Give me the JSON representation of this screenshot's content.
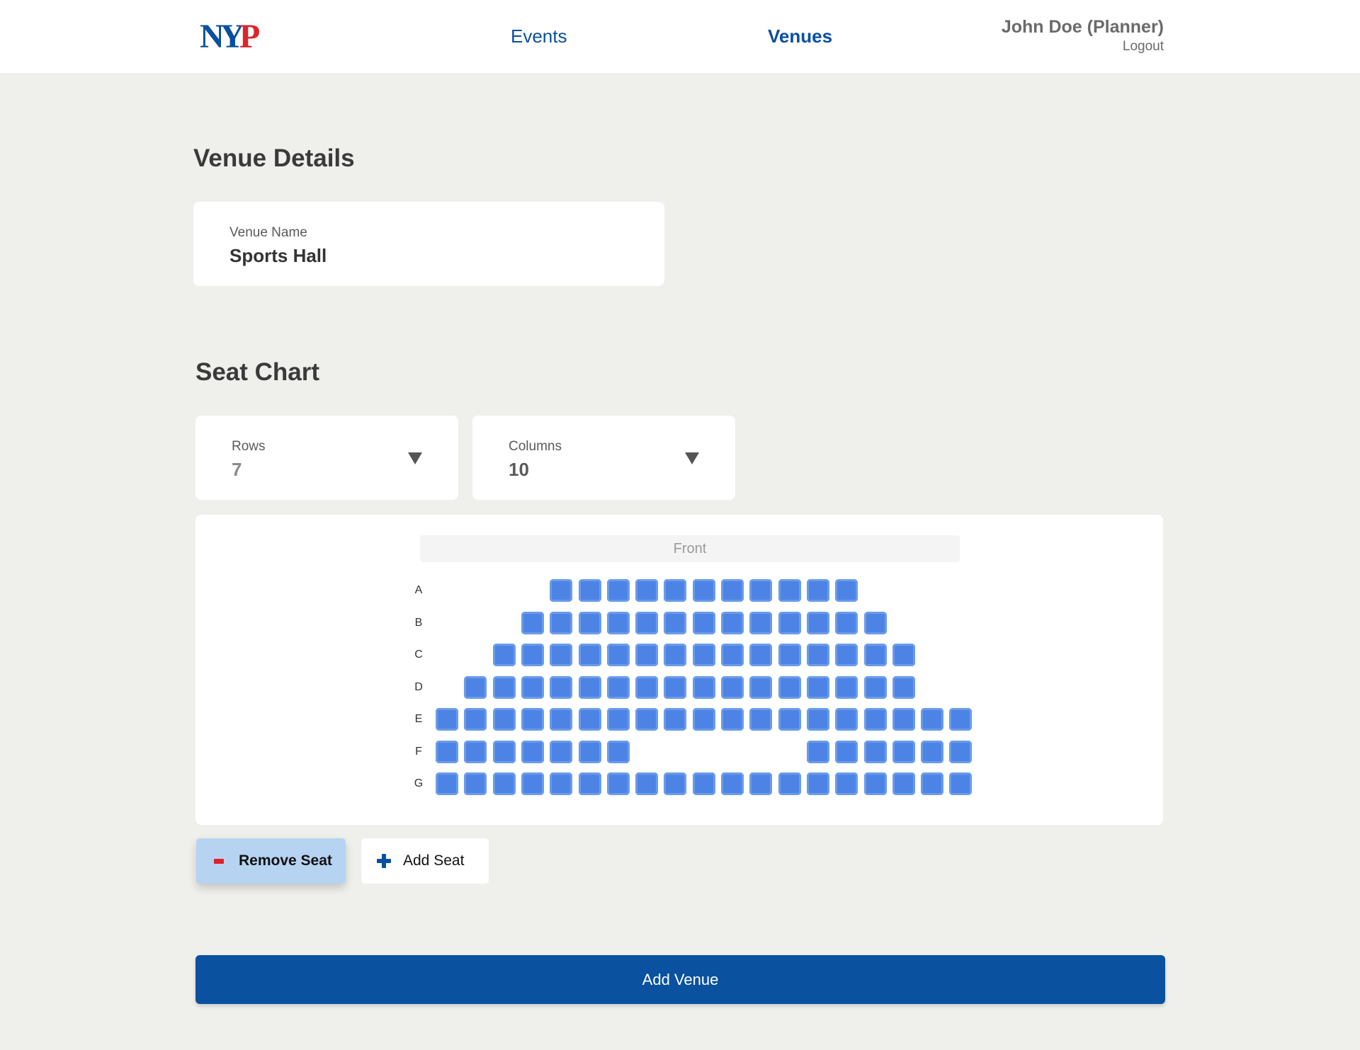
{
  "header": {
    "logo_text": "NYP",
    "nav": [
      {
        "label": "Events",
        "active": false
      },
      {
        "label": "Venues",
        "active": true
      }
    ],
    "user_name": "John Doe (Planner)",
    "logout_label": "Logout"
  },
  "venue_details": {
    "title": "Venue Details",
    "name_label": "Venue Name",
    "name_value": "Sports Hall"
  },
  "seat_chart": {
    "title": "Seat Chart",
    "rows_label": "Rows",
    "rows_value": "7",
    "columns_label": "Columns",
    "columns_value": "10",
    "front_label": "Front",
    "seat_color": "#4e83e6",
    "rows": [
      {
        "label": "A",
        "seats": [
          5,
          6,
          7,
          8,
          9,
          10,
          11,
          12,
          13,
          14,
          15
        ]
      },
      {
        "label": "B",
        "seats": [
          4,
          5,
          6,
          7,
          8,
          9,
          10,
          11,
          12,
          13,
          14,
          15,
          16
        ]
      },
      {
        "label": "C",
        "seats": [
          3,
          4,
          5,
          6,
          7,
          8,
          9,
          10,
          11,
          12,
          13,
          14,
          15,
          16,
          17
        ]
      },
      {
        "label": "D",
        "seats": [
          2,
          3,
          4,
          5,
          6,
          7,
          8,
          9,
          10,
          11,
          12,
          13,
          14,
          15,
          16,
          17
        ]
      },
      {
        "label": "E",
        "seats": [
          1,
          2,
          3,
          4,
          5,
          6,
          7,
          8,
          9,
          10,
          11,
          12,
          13,
          14,
          15,
          16,
          17,
          18,
          19
        ]
      },
      {
        "label": "F",
        "seats": [
          1,
          2,
          3,
          4,
          5,
          6,
          7,
          14,
          15,
          16,
          17,
          18,
          19
        ]
      },
      {
        "label": "G",
        "seats": [
          1,
          2,
          3,
          4,
          5,
          6,
          7,
          8,
          9,
          10,
          11,
          12,
          13,
          14,
          15,
          16,
          17,
          18,
          19
        ]
      }
    ]
  },
  "actions": {
    "remove_seat_label": "Remove Seat",
    "add_seat_label": "Add Seat",
    "add_venue_label": "Add Venue"
  },
  "colors": {
    "primary": "#0a51a0",
    "nav_text": "#0a4f9f",
    "remove_button_bg": "#b7d3f2",
    "minus_icon": "#e0202a",
    "logo_red": "#d9262c"
  }
}
